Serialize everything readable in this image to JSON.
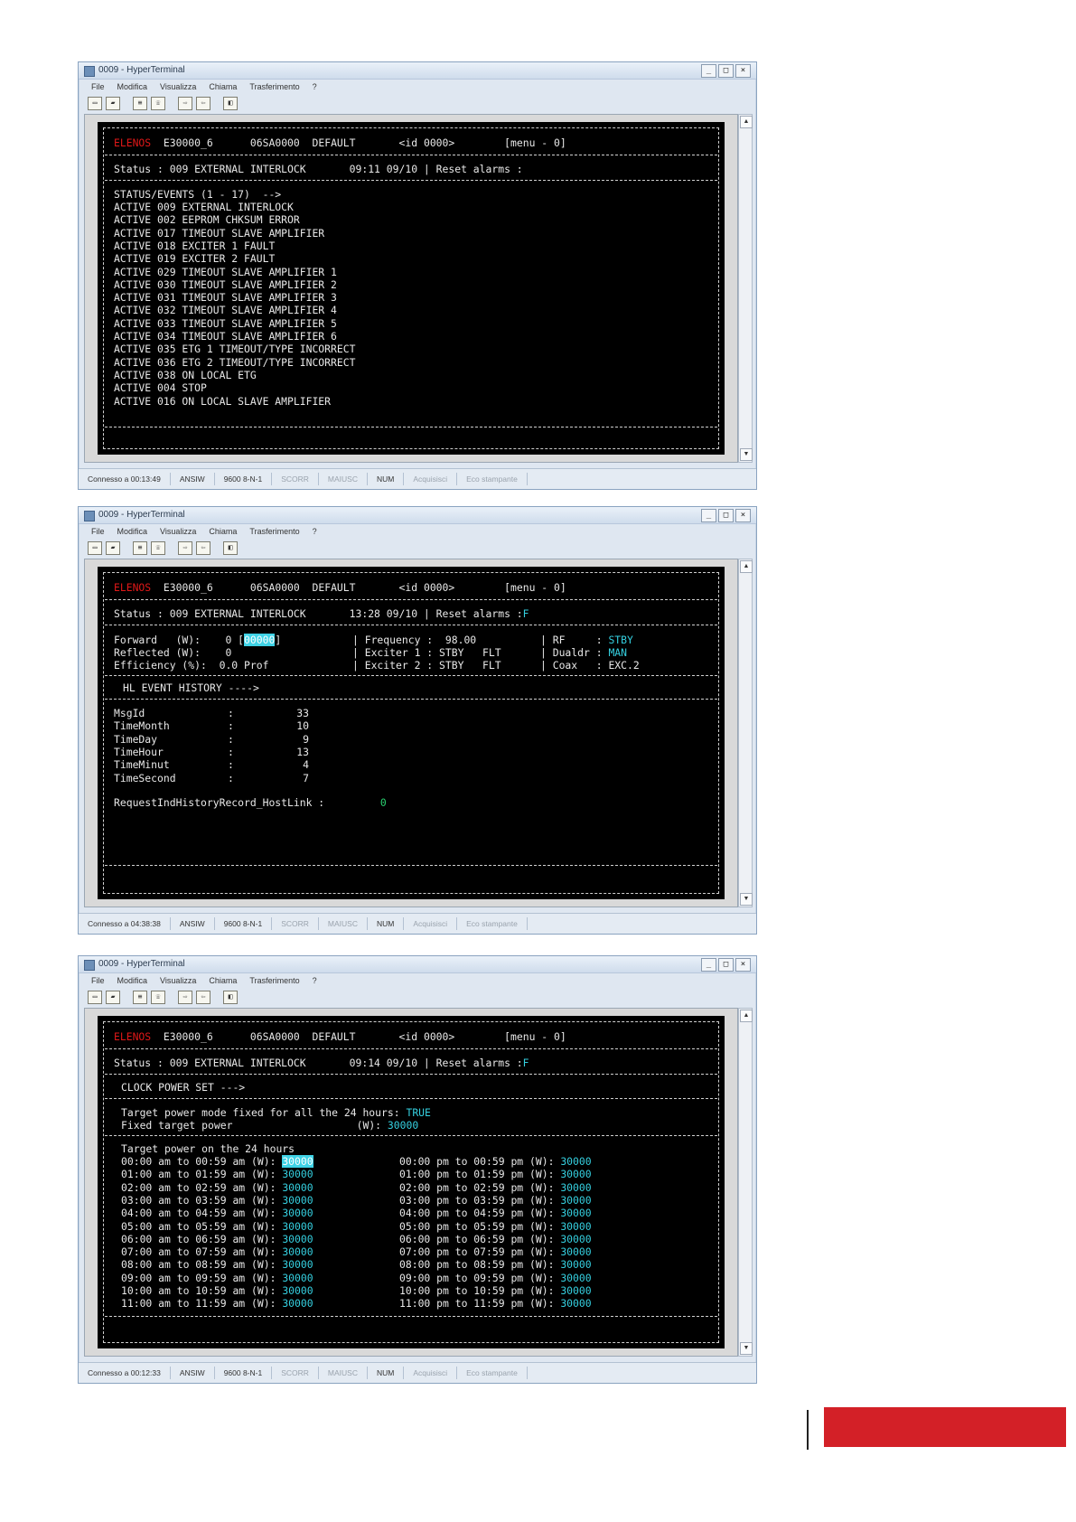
{
  "windows": [
    {
      "title": "0009 - HyperTerminal",
      "menu": [
        "File",
        "Modifica",
        "Visualizza",
        "Chiama",
        "Trasferimento",
        "?"
      ],
      "toolbar_icons": [
        "new-icon",
        "open-icon",
        "disconnect-icon",
        "call-icon",
        "send-icon",
        "receive-icon",
        "properties-icon"
      ],
      "status_bar": [
        "Connesso a 00:13:49",
        "ANSIW",
        "9600 8-N-1",
        "SCORR",
        "MAIUSC",
        "NUM",
        "Acquisisci",
        "Eco stampante"
      ],
      "terminal": {
        "header": {
          "brand": "ELENOS",
          "model": "E30000_6",
          "serial": "06SA0000",
          "profile": "DEFAULT",
          "id": "<id 0000>",
          "menu": "[menu - 0]"
        },
        "status": {
          "label": "Status :",
          "code": "009 EXTERNAL INTERLOCK",
          "time": "09:11 09/10",
          "pipe": "|",
          "reset": "Reset alarms :",
          "value": ""
        },
        "title": "STATUS/EVENTS (1 - 17)  -->",
        "lines": [
          "ACTIVE 009 EXTERNAL INTERLOCK",
          "ACTIVE 002 EEPROM CHKSUM ERROR",
          "ACTIVE 017 TIMEOUT SLAVE AMPLIFIER",
          "ACTIVE 018 EXCITER 1 FAULT",
          "ACTIVE 019 EXCITER 2 FAULT",
          "ACTIVE 029 TIMEOUT SLAVE AMPLIFIER 1",
          "ACTIVE 030 TIMEOUT SLAVE AMPLIFIER 2",
          "ACTIVE 031 TIMEOUT SLAVE AMPLIFIER 3",
          "ACTIVE 032 TIMEOUT SLAVE AMPLIFIER 4",
          "ACTIVE 033 TIMEOUT SLAVE AMPLIFIER 5",
          "ACTIVE 034 TIMEOUT SLAVE AMPLIFIER 6",
          "ACTIVE 035 ETG 1 TIMEOUT/TYPE INCORRECT",
          "ACTIVE 036 ETG 2 TIMEOUT/TYPE INCORRECT",
          "ACTIVE 038 ON LOCAL ETG",
          "ACTIVE 004 STOP",
          "ACTIVE 016 ON LOCAL SLAVE AMPLIFIER"
        ]
      }
    },
    {
      "title": "0009 - HyperTerminal",
      "menu": [
        "File",
        "Modifica",
        "Visualizza",
        "Chiama",
        "Trasferimento",
        "?"
      ],
      "toolbar_icons": [
        "new-icon",
        "open-icon",
        "disconnect-icon",
        "call-icon",
        "send-icon",
        "receive-icon",
        "properties-icon"
      ],
      "status_bar": [
        "Connesso a 04:38:38",
        "ANSIW",
        "9600 8-N-1",
        "SCORR",
        "MAIUSC",
        "NUM",
        "Acquisisci",
        "Eco stampante"
      ],
      "terminal": {
        "header": {
          "brand": "ELENOS",
          "model": "E30000_6",
          "serial": "06SA0000",
          "profile": "DEFAULT",
          "id": "<id 0000>",
          "menu": "[menu - 0]"
        },
        "status": {
          "label": "Status :",
          "code": "009 EXTERNAL INTERLOCK",
          "time": "13:28 09/10",
          "pipe": "|",
          "reset": "Reset alarms :",
          "value": "F"
        },
        "measures": {
          "forward_label": "Forward   (W):",
          "forward_value": "0",
          "forward_target": "00000",
          "reflected_label": "Reflected (W):",
          "reflected_value": "0",
          "efficiency_label": "Efficiency (%):",
          "efficiency_value": "0.0 Prof",
          "frequency_label": "Frequency :",
          "frequency_value": "98.00",
          "exciter1_label": "Exciter 1 :",
          "exciter1_value": "STBY   FLT",
          "exciter2_label": "Exciter 2 :",
          "exciter2_value": "STBY   FLT",
          "rf_label": "RF     :",
          "rf_value": "STBY",
          "dualdr_label": "Dualdr :",
          "dualdr_value": "MAN",
          "coax_label": "Coax   :",
          "coax_value": "EXC.2"
        },
        "history_title": "HL EVENT HISTORY ---->",
        "history": [
          {
            "label": "MsgId",
            "value": "33"
          },
          {
            "label": "TimeMonth",
            "value": "10"
          },
          {
            "label": "TimeDay",
            "value": "9"
          },
          {
            "label": "TimeHour",
            "value": "13"
          },
          {
            "label": "TimeMinut",
            "value": "4"
          },
          {
            "label": "TimeSecond",
            "value": "7"
          }
        ],
        "request_label": "RequestIndHistoryRecord_HostLink :",
        "request_value": "0"
      }
    },
    {
      "title": "0009 - HyperTerminal",
      "menu": [
        "File",
        "Modifica",
        "Visualizza",
        "Chiama",
        "Trasferimento",
        "?"
      ],
      "toolbar_icons": [
        "new-icon",
        "open-icon",
        "disconnect-icon",
        "call-icon",
        "send-icon",
        "receive-icon",
        "properties-icon"
      ],
      "status_bar": [
        "Connesso a 00:12:33",
        "ANSIW",
        "9600 8-N-1",
        "SCORR",
        "MAIUSC",
        "NUM",
        "Acquisisci",
        "Eco stampante"
      ],
      "terminal": {
        "header": {
          "brand": "ELENOS",
          "model": "E30000_6",
          "serial": "06SA0000",
          "profile": "DEFAULT",
          "id": "<id 0000>",
          "menu": "[menu - 0]"
        },
        "status": {
          "label": "Status :",
          "code": "009 EXTERNAL INTERLOCK",
          "time": "09:14 09/10",
          "pipe": "|",
          "reset": "Reset alarms :",
          "value": "F"
        },
        "title": "CLOCK POWER SET --->",
        "mode_label": "Target power mode fixed for all the 24 hours:",
        "mode_value": "TRUE",
        "fixed_label": "Fixed target power",
        "fixed_unit": "(W):",
        "fixed_value": "30000",
        "table_title": "Target power on the 24 hours",
        "am": [
          {
            "label": "00:00 am to 00:59 am (W):",
            "value": "30000"
          },
          {
            "label": "01:00 am to 01:59 am (W):",
            "value": "30000"
          },
          {
            "label": "02:00 am to 02:59 am (W):",
            "value": "30000"
          },
          {
            "label": "03:00 am to 03:59 am (W):",
            "value": "30000"
          },
          {
            "label": "04:00 am to 04:59 am (W):",
            "value": "30000"
          },
          {
            "label": "05:00 am to 05:59 am (W):",
            "value": "30000"
          },
          {
            "label": "06:00 am to 06:59 am (W):",
            "value": "30000"
          },
          {
            "label": "07:00 am to 07:59 am (W):",
            "value": "30000"
          },
          {
            "label": "08:00 am to 08:59 am (W):",
            "value": "30000"
          },
          {
            "label": "09:00 am to 09:59 am (W):",
            "value": "30000"
          },
          {
            "label": "10:00 am to 10:59 am (W):",
            "value": "30000"
          },
          {
            "label": "11:00 am to 11:59 am (W):",
            "value": "30000"
          }
        ],
        "pm": [
          {
            "label": "00:00 pm to 00:59 pm (W):",
            "value": "30000"
          },
          {
            "label": "01:00 pm to 01:59 pm (W):",
            "value": "30000"
          },
          {
            "label": "02:00 pm to 02:59 pm (W):",
            "value": "30000"
          },
          {
            "label": "03:00 pm to 03:59 pm (W):",
            "value": "30000"
          },
          {
            "label": "04:00 pm to 04:59 pm (W):",
            "value": "30000"
          },
          {
            "label": "05:00 pm to 05:59 pm (W):",
            "value": "30000"
          },
          {
            "label": "06:00 pm to 06:59 pm (W):",
            "value": "30000"
          },
          {
            "label": "07:00 pm to 07:59 pm (W):",
            "value": "30000"
          },
          {
            "label": "08:00 pm to 08:59 pm (W):",
            "value": "30000"
          },
          {
            "label": "09:00 pm to 09:59 pm (W):",
            "value": "30000"
          },
          {
            "label": "10:00 pm to 10:59 pm (W):",
            "value": "30000"
          },
          {
            "label": "11:00 pm to 11:59 pm (W):",
            "value": "30000"
          }
        ]
      }
    }
  ],
  "colors": {
    "brand_red": "#d32027",
    "terminal_bg": "#000000",
    "terminal_fg": "#e8e8e8",
    "terminal_cyan": "#35d0e0",
    "terminal_green": "#2ad070"
  }
}
